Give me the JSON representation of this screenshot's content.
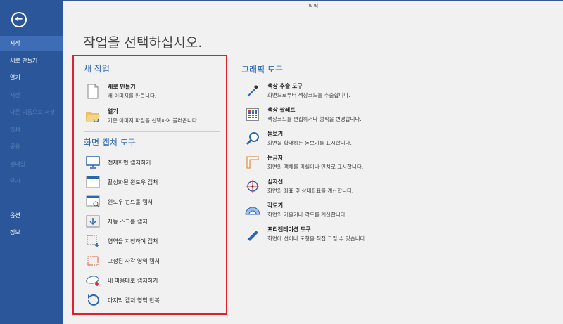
{
  "window": {
    "title": "픽픽"
  },
  "sidebar": {
    "items": [
      {
        "label": "시작",
        "state": "active"
      },
      {
        "label": "새로 만들기",
        "state": "enabled"
      },
      {
        "label": "열기",
        "state": "enabled"
      },
      {
        "label": "저장",
        "state": "disabled"
      },
      {
        "label": "다른 이름으로 저장",
        "state": "disabled"
      },
      {
        "label": "인쇄",
        "state": "disabled"
      },
      {
        "label": "공유",
        "state": "disabled"
      },
      {
        "label": "썸네일",
        "state": "disabled"
      },
      {
        "label": "닫기",
        "state": "disabled"
      },
      {
        "label": "옵션",
        "state": "enabled"
      },
      {
        "label": "정보",
        "state": "enabled"
      }
    ]
  },
  "main": {
    "heading": "작업을 선택하십시오.",
    "new_task": {
      "title": "새 작업",
      "items": [
        {
          "label": "새로 만들기",
          "desc": "새 이미지를 만듭니다."
        },
        {
          "label": "열기",
          "desc": "기존 이미지 파일을 선택하여 불러옵니다."
        }
      ]
    },
    "capture": {
      "title": "화면 캡처 도구",
      "items": [
        {
          "label": "전체화면 캡처하기"
        },
        {
          "label": "활성화된 윈도우 캡처"
        },
        {
          "label": "윈도우 컨트롤 캡처"
        },
        {
          "label": "자동 스크롤 캡처"
        },
        {
          "label": "영역을 지정하여 캡처"
        },
        {
          "label": "고정된 사각 영역 캡처"
        },
        {
          "label": "내 마음대로 캡처하기"
        },
        {
          "label": "마지막 캡처 영역 반복"
        }
      ]
    },
    "graphic": {
      "title": "그래픽 도구",
      "items": [
        {
          "label": "색상 추출 도구",
          "desc": "화면으로부터 색상코드를 추출합니다."
        },
        {
          "label": "색상 팔레트",
          "desc": "색상코드를 편집하거나 형식을 변경합니다."
        },
        {
          "label": "돋보기",
          "desc": "화면을 확대하는 돋보기를 표시합니다."
        },
        {
          "label": "눈금자",
          "desc": "화면의 객체를 픽셀이나 인치로 표시합니다."
        },
        {
          "label": "십자선",
          "desc": "화면의 좌표 및 상대좌표를 계산합니다."
        },
        {
          "label": "각도기",
          "desc": "화면의 기울기나 각도를 계산합니다."
        },
        {
          "label": "프리젠테이션 도구",
          "desc": "화면에 선이나 도형을 직접 그릴 수 있습니다."
        }
      ]
    }
  }
}
